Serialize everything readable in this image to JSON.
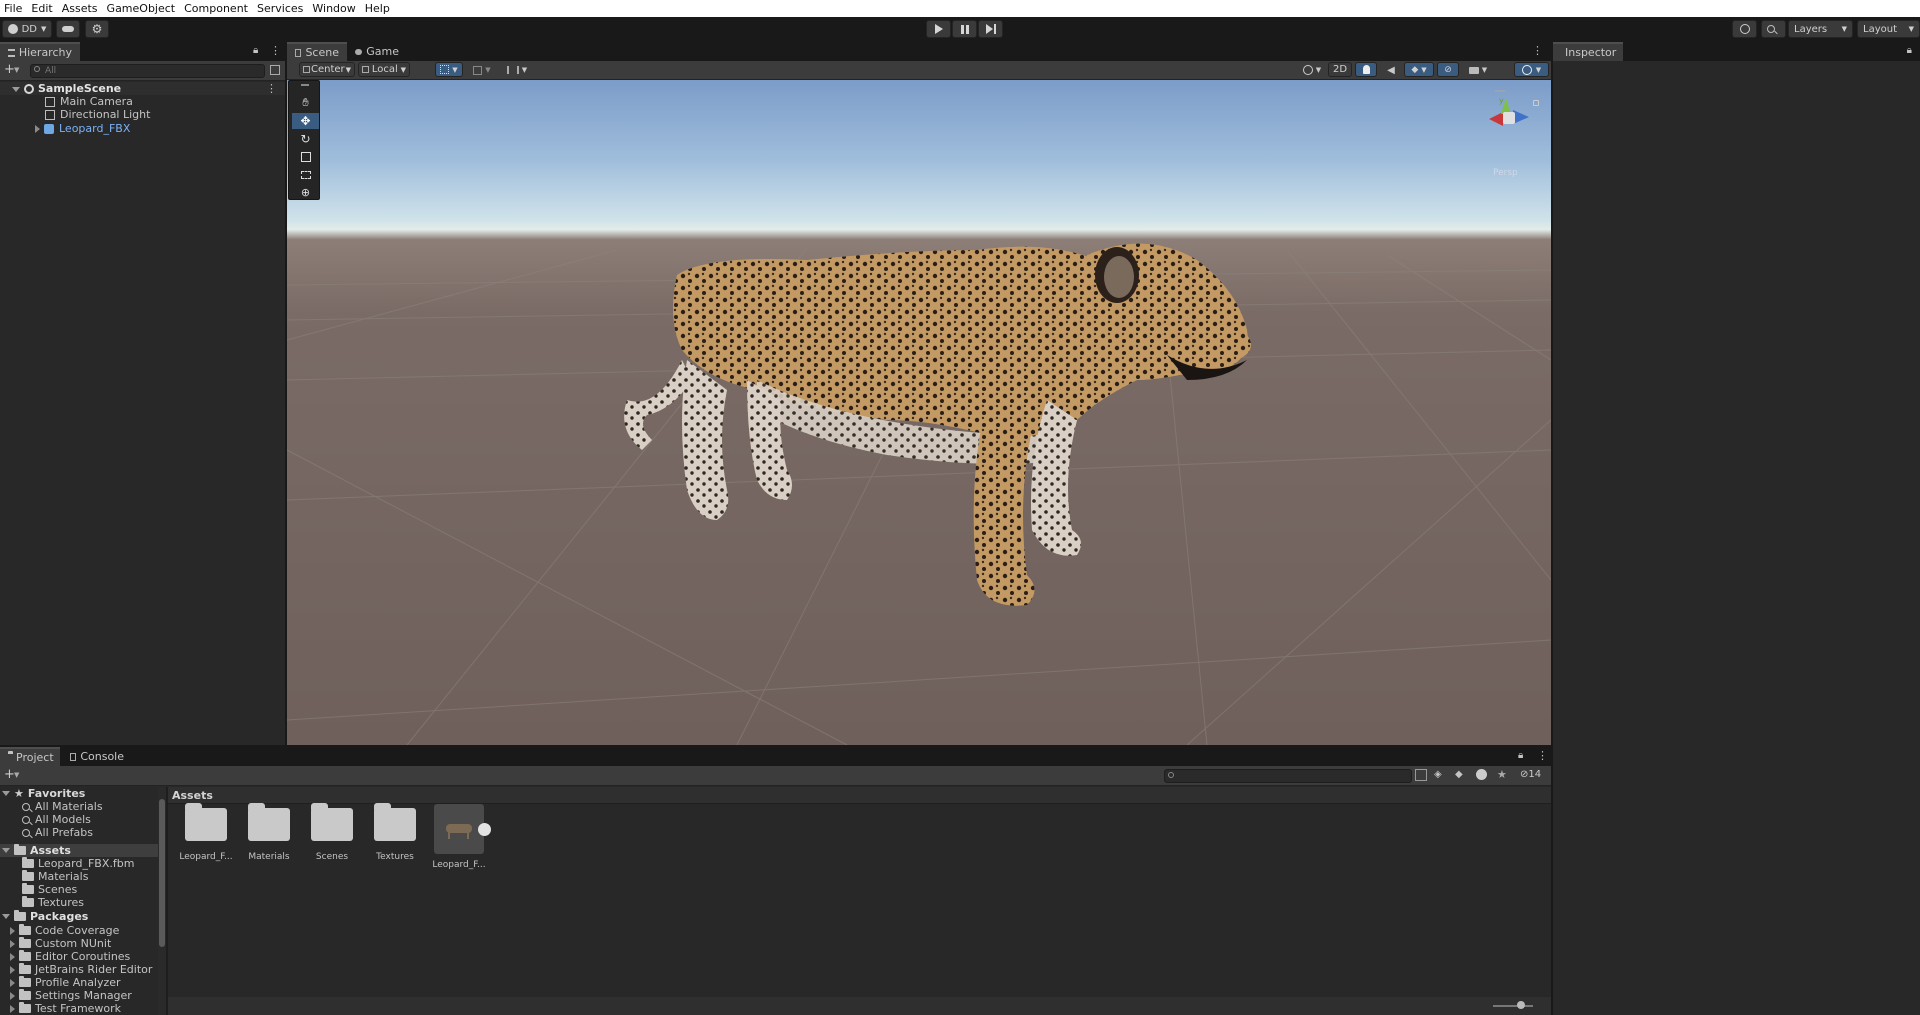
{
  "menu": [
    "File",
    "Edit",
    "Assets",
    "GameObject",
    "Component",
    "Services",
    "Window",
    "Help"
  ],
  "toolbar": {
    "account_label": "DD",
    "layers_label": "Layers",
    "layout_label": "Layout"
  },
  "hierarchy": {
    "tab": "Hierarchy",
    "search_placeholder": "All",
    "scene_name": "SampleScene",
    "items": [
      {
        "label": "Main Camera",
        "icon": "gameobject-cube-icon"
      },
      {
        "label": "Directional Light",
        "icon": "gameobject-cube-icon"
      },
      {
        "label": "Leopard_FBX",
        "icon": "prefab-cube-icon",
        "color": "#7ab2f7"
      }
    ]
  },
  "scene": {
    "tabs": [
      "Scene",
      "Game"
    ],
    "pivot_mode": "Center",
    "pivot_rotation": "Local",
    "mode_2d": "2D",
    "gizmo_label": "Persp",
    "axis_y": "y"
  },
  "inspector": {
    "tab": "Inspector"
  },
  "project": {
    "tabs": [
      "Project",
      "Console"
    ],
    "favorites_label": "Favorites",
    "favorites": [
      "All Materials",
      "All Models",
      "All Prefabs"
    ],
    "assets_label": "Assets",
    "assets_tree": [
      "Leopard_FBX.fbm",
      "Materials",
      "Scenes",
      "Textures"
    ],
    "packages_label": "Packages",
    "packages": [
      "Code Coverage",
      "Custom NUnit",
      "Editor Coroutines",
      "JetBrains Rider Editor",
      "Profile Analyzer",
      "Settings Manager",
      "Test Framework"
    ],
    "breadcrumb": "Assets",
    "grid_items": [
      "Leopard_F...",
      "Materials",
      "Scenes",
      "Textures",
      "Leopard_F..."
    ],
    "hidden_count": "14"
  },
  "colors": {
    "accent_blue": "#3a79bb",
    "selection": "#2c5d87",
    "panel": "#282828",
    "header": "#191919"
  }
}
